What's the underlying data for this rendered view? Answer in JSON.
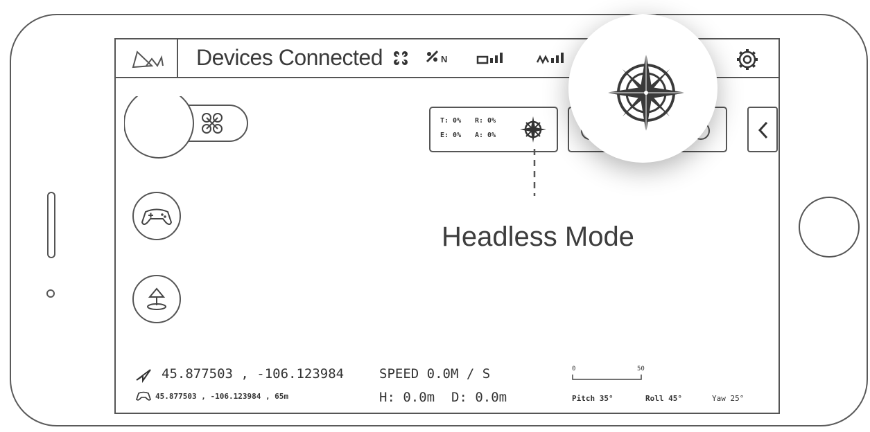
{
  "topbar": {
    "title": "Devices Connected",
    "icons": [
      "drone-logo-icon",
      "propeller-icon",
      "gps-signal-icon",
      "battery-signal-icon",
      "remote-signal-icon",
      "gear-icon"
    ],
    "gps_label": "N"
  },
  "telemetry": {
    "t": "T: 0%",
    "r": "R: 0%",
    "e": "E: 0%",
    "a": "A: 0%"
  },
  "annotation": "Headless Mode",
  "footer": {
    "drone_coords": "45.877503 , -106.123984",
    "remote_info": "45.877503 , -106.123984 , 65m",
    "speed": "SPEED 0.0M / S",
    "height": "H: 0.0m",
    "distance": "D: 0.0m",
    "scale_min": "0",
    "scale_max": "50",
    "pitch": "Pitch 35°",
    "roll": "Roll 45°",
    "yaw": "Yaw 25°"
  }
}
